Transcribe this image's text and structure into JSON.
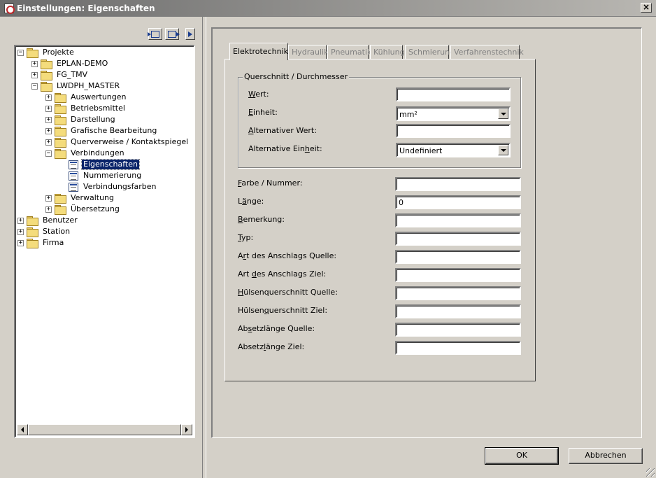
{
  "window": {
    "title": "Einstellungen: Eigenschaften",
    "close_glyph": "×"
  },
  "tree": {
    "items": [
      {
        "label": "Projekte",
        "level": 0,
        "expander": "−",
        "icon": "folder-icon"
      },
      {
        "label": "EPLAN-DEMO",
        "level": 1,
        "expander": "+",
        "icon": "folder-icon"
      },
      {
        "label": "FG_TMV",
        "level": 1,
        "expander": "+",
        "icon": "folder-icon"
      },
      {
        "label": "LWDPH_MASTER",
        "level": 1,
        "expander": "−",
        "icon": "folder-icon"
      },
      {
        "label": "Auswertungen",
        "level": 2,
        "expander": "+",
        "icon": "folder-icon"
      },
      {
        "label": "Betriebsmittel",
        "level": 2,
        "expander": "+",
        "icon": "folder-icon"
      },
      {
        "label": "Darstellung",
        "level": 2,
        "expander": "+",
        "icon": "folder-icon"
      },
      {
        "label": "Grafische Bearbeitung",
        "level": 2,
        "expander": "+",
        "icon": "folder-icon"
      },
      {
        "label": "Querverweise / Kontaktspiegel",
        "level": 2,
        "expander": "+",
        "icon": "folder-icon"
      },
      {
        "label": "Verbindungen",
        "level": 2,
        "expander": "−",
        "icon": "folder-icon"
      },
      {
        "label": "Eigenschaften",
        "level": 3,
        "expander": "",
        "icon": "settings-page-icon",
        "selected": true
      },
      {
        "label": "Nummerierung",
        "level": 3,
        "expander": "",
        "icon": "settings-page-icon"
      },
      {
        "label": "Verbindungsfarben",
        "level": 3,
        "expander": "",
        "icon": "settings-page-icon"
      },
      {
        "label": "Verwaltung",
        "level": 2,
        "expander": "+",
        "icon": "folder-icon"
      },
      {
        "label": "Übersetzung",
        "level": 2,
        "expander": "+",
        "icon": "folder-icon"
      },
      {
        "label": "Benutzer",
        "level": 0,
        "expander": "+",
        "icon": "folder-icon"
      },
      {
        "label": "Station",
        "level": 0,
        "expander": "+",
        "icon": "folder-icon"
      },
      {
        "label": "Firma",
        "level": 0,
        "expander": "+",
        "icon": "folder-icon"
      }
    ]
  },
  "tabs": [
    "Elektrotechnik",
    "Hydraulik",
    "Pneumatik",
    "Kühlung",
    "Schmierung",
    "Verfahrenstechnik"
  ],
  "active_tab": "Elektrotechnik",
  "group": {
    "title": "Querschnitt / Durchmesser",
    "fields": [
      {
        "label": "Wert:",
        "accel": "W",
        "rest": "ert:",
        "type": "text",
        "value": ""
      },
      {
        "label": "Einheit:",
        "accel": "E",
        "rest": "inheit:",
        "type": "select",
        "value": "mm²"
      },
      {
        "label": "Alternativer Wert:",
        "accel": "A",
        "rest": "lternativer Wert:",
        "type": "text",
        "value": ""
      },
      {
        "label": "Alternative Einheit:",
        "pre": "Alternative Ein",
        "accel": "h",
        "rest": "eit:",
        "type": "select",
        "value": "Undefiniert"
      }
    ]
  },
  "fields": [
    {
      "name": "farbe-nummer",
      "pre": "",
      "accel": "F",
      "rest": "arbe / Nummer:",
      "value": ""
    },
    {
      "name": "laenge",
      "pre": "L",
      "accel": "ä",
      "rest": "nge:",
      "value": "0"
    },
    {
      "name": "bemerkung",
      "pre": "",
      "accel": "B",
      "rest": "emerkung:",
      "value": ""
    },
    {
      "name": "typ",
      "pre": "",
      "accel": "T",
      "rest": "yp:",
      "value": ""
    },
    {
      "name": "art-anschlag-quelle",
      "pre": "A",
      "accel": "r",
      "rest": "t des Anschlags Quelle:",
      "value": ""
    },
    {
      "name": "art-anschlag-ziel",
      "pre": "Art ",
      "accel": "d",
      "rest": "es Anschlags Ziel:",
      "value": ""
    },
    {
      "name": "huelsenquerschnitt-quelle",
      "pre": "",
      "accel": "H",
      "rest": "ülsenquerschnitt Quelle:",
      "value": ""
    },
    {
      "name": "huelsenquerschnitt-ziel",
      "pre": "Hülsen",
      "accel": "q",
      "rest": "uerschnitt Ziel:",
      "value": ""
    },
    {
      "name": "absetzlaenge-quelle",
      "pre": "Ab",
      "accel": "s",
      "rest": "etzlänge Quelle:",
      "value": ""
    },
    {
      "name": "absetzlaenge-ziel",
      "pre": "Absetz",
      "accel": "l",
      "rest": "änge Ziel:",
      "value": ""
    }
  ],
  "buttons": {
    "ok": "OK",
    "cancel": "Abbrechen"
  }
}
